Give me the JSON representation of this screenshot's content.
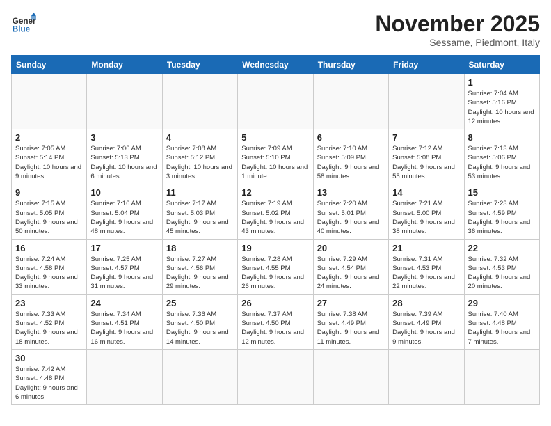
{
  "header": {
    "logo_general": "General",
    "logo_blue": "Blue",
    "month_title": "November 2025",
    "subtitle": "Sessame, Piedmont, Italy"
  },
  "days_of_week": [
    "Sunday",
    "Monday",
    "Tuesday",
    "Wednesday",
    "Thursday",
    "Friday",
    "Saturday"
  ],
  "weeks": [
    [
      {
        "day": "",
        "info": ""
      },
      {
        "day": "",
        "info": ""
      },
      {
        "day": "",
        "info": ""
      },
      {
        "day": "",
        "info": ""
      },
      {
        "day": "",
        "info": ""
      },
      {
        "day": "",
        "info": ""
      },
      {
        "day": "1",
        "info": "Sunrise: 7:04 AM\nSunset: 5:16 PM\nDaylight: 10 hours and 12 minutes."
      }
    ],
    [
      {
        "day": "2",
        "info": "Sunrise: 7:05 AM\nSunset: 5:14 PM\nDaylight: 10 hours and 9 minutes."
      },
      {
        "day": "3",
        "info": "Sunrise: 7:06 AM\nSunset: 5:13 PM\nDaylight: 10 hours and 6 minutes."
      },
      {
        "day": "4",
        "info": "Sunrise: 7:08 AM\nSunset: 5:12 PM\nDaylight: 10 hours and 3 minutes."
      },
      {
        "day": "5",
        "info": "Sunrise: 7:09 AM\nSunset: 5:10 PM\nDaylight: 10 hours and 1 minute."
      },
      {
        "day": "6",
        "info": "Sunrise: 7:10 AM\nSunset: 5:09 PM\nDaylight: 9 hours and 58 minutes."
      },
      {
        "day": "7",
        "info": "Sunrise: 7:12 AM\nSunset: 5:08 PM\nDaylight: 9 hours and 55 minutes."
      },
      {
        "day": "8",
        "info": "Sunrise: 7:13 AM\nSunset: 5:06 PM\nDaylight: 9 hours and 53 minutes."
      }
    ],
    [
      {
        "day": "9",
        "info": "Sunrise: 7:15 AM\nSunset: 5:05 PM\nDaylight: 9 hours and 50 minutes."
      },
      {
        "day": "10",
        "info": "Sunrise: 7:16 AM\nSunset: 5:04 PM\nDaylight: 9 hours and 48 minutes."
      },
      {
        "day": "11",
        "info": "Sunrise: 7:17 AM\nSunset: 5:03 PM\nDaylight: 9 hours and 45 minutes."
      },
      {
        "day": "12",
        "info": "Sunrise: 7:19 AM\nSunset: 5:02 PM\nDaylight: 9 hours and 43 minutes."
      },
      {
        "day": "13",
        "info": "Sunrise: 7:20 AM\nSunset: 5:01 PM\nDaylight: 9 hours and 40 minutes."
      },
      {
        "day": "14",
        "info": "Sunrise: 7:21 AM\nSunset: 5:00 PM\nDaylight: 9 hours and 38 minutes."
      },
      {
        "day": "15",
        "info": "Sunrise: 7:23 AM\nSunset: 4:59 PM\nDaylight: 9 hours and 36 minutes."
      }
    ],
    [
      {
        "day": "16",
        "info": "Sunrise: 7:24 AM\nSunset: 4:58 PM\nDaylight: 9 hours and 33 minutes."
      },
      {
        "day": "17",
        "info": "Sunrise: 7:25 AM\nSunset: 4:57 PM\nDaylight: 9 hours and 31 minutes."
      },
      {
        "day": "18",
        "info": "Sunrise: 7:27 AM\nSunset: 4:56 PM\nDaylight: 9 hours and 29 minutes."
      },
      {
        "day": "19",
        "info": "Sunrise: 7:28 AM\nSunset: 4:55 PM\nDaylight: 9 hours and 26 minutes."
      },
      {
        "day": "20",
        "info": "Sunrise: 7:29 AM\nSunset: 4:54 PM\nDaylight: 9 hours and 24 minutes."
      },
      {
        "day": "21",
        "info": "Sunrise: 7:31 AM\nSunset: 4:53 PM\nDaylight: 9 hours and 22 minutes."
      },
      {
        "day": "22",
        "info": "Sunrise: 7:32 AM\nSunset: 4:53 PM\nDaylight: 9 hours and 20 minutes."
      }
    ],
    [
      {
        "day": "23",
        "info": "Sunrise: 7:33 AM\nSunset: 4:52 PM\nDaylight: 9 hours and 18 minutes."
      },
      {
        "day": "24",
        "info": "Sunrise: 7:34 AM\nSunset: 4:51 PM\nDaylight: 9 hours and 16 minutes."
      },
      {
        "day": "25",
        "info": "Sunrise: 7:36 AM\nSunset: 4:50 PM\nDaylight: 9 hours and 14 minutes."
      },
      {
        "day": "26",
        "info": "Sunrise: 7:37 AM\nSunset: 4:50 PM\nDaylight: 9 hours and 12 minutes."
      },
      {
        "day": "27",
        "info": "Sunrise: 7:38 AM\nSunset: 4:49 PM\nDaylight: 9 hours and 11 minutes."
      },
      {
        "day": "28",
        "info": "Sunrise: 7:39 AM\nSunset: 4:49 PM\nDaylight: 9 hours and 9 minutes."
      },
      {
        "day": "29",
        "info": "Sunrise: 7:40 AM\nSunset: 4:48 PM\nDaylight: 9 hours and 7 minutes."
      }
    ],
    [
      {
        "day": "30",
        "info": "Sunrise: 7:42 AM\nSunset: 4:48 PM\nDaylight: 9 hours and 6 minutes."
      },
      {
        "day": "",
        "info": ""
      },
      {
        "day": "",
        "info": ""
      },
      {
        "day": "",
        "info": ""
      },
      {
        "day": "",
        "info": ""
      },
      {
        "day": "",
        "info": ""
      },
      {
        "day": "",
        "info": ""
      }
    ]
  ]
}
